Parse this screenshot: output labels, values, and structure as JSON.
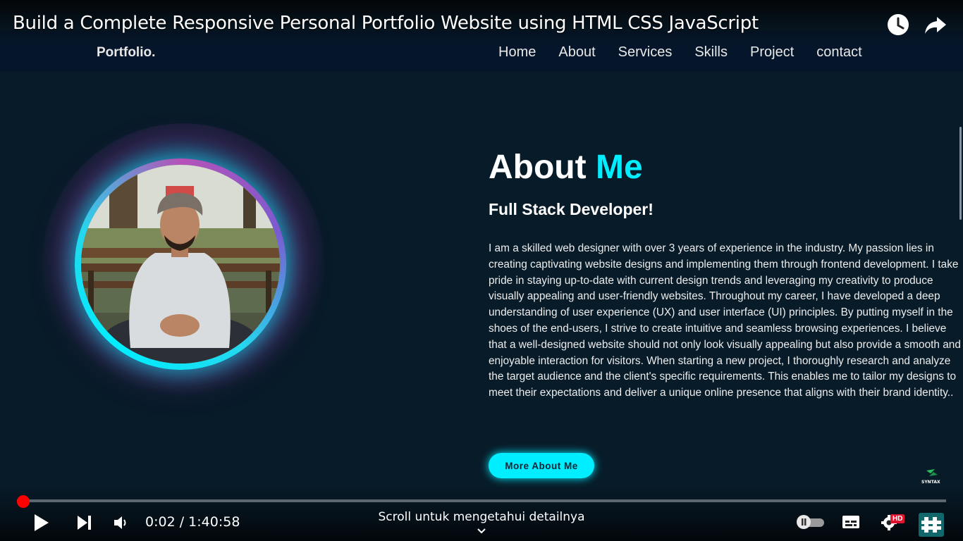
{
  "video": {
    "title": "Build a Complete Responsive Personal Portfolio Website using HTML CSS JavaScript",
    "current_time": "0:02",
    "separator": "/",
    "duration": "1:40:58",
    "progress_fraction": 0.0003,
    "scroll_hint": "Scroll untuk mengetahui detailnya",
    "hd_badge": "HD"
  },
  "site": {
    "logo": "Portfolio.",
    "nav": [
      "Home",
      "About",
      "Services",
      "Skills",
      "Project",
      "contact"
    ],
    "about": {
      "title_main": "About",
      "title_accent": "Me",
      "subtitle": "Full Stack Developer!",
      "paragraph": "I am a skilled web designer with over 3 years of experience in the industry. My passion lies in creating captivating website designs and implementing them through frontend development. I take pride in staying up-to-date with current design trends and leveraging my creativity to produce visually appealing and user-friendly websites. Throughout my career, I have developed a deep understanding of user experience (UX) and user interface (UI) principles. By putting myself in the shoes of the end-users, I strive to create intuitive and seamless browsing experiences. I believe that a well-designed website should not only look visually appealing but also provide a smooth and enjoyable interaction for visitors. When starting a new project, I thoroughly research and analyze the target audience and the client's specific requirements. This enables me to tailor my designs to meet their expectations and deliver a unique online presence that aligns with their brand identity..",
      "button": "More About Me"
    },
    "watermark": "SYNTAX"
  },
  "colors": {
    "background": "#081b29",
    "accent": "#00eeff",
    "progress": "#ff0000"
  },
  "icons": [
    "watch-later-icon",
    "share-icon",
    "play-icon",
    "next-icon",
    "volume-icon",
    "autoplay-toggle-icon",
    "subtitles-icon",
    "settings-icon",
    "channel-logo-icon",
    "chevron-down-icon"
  ]
}
